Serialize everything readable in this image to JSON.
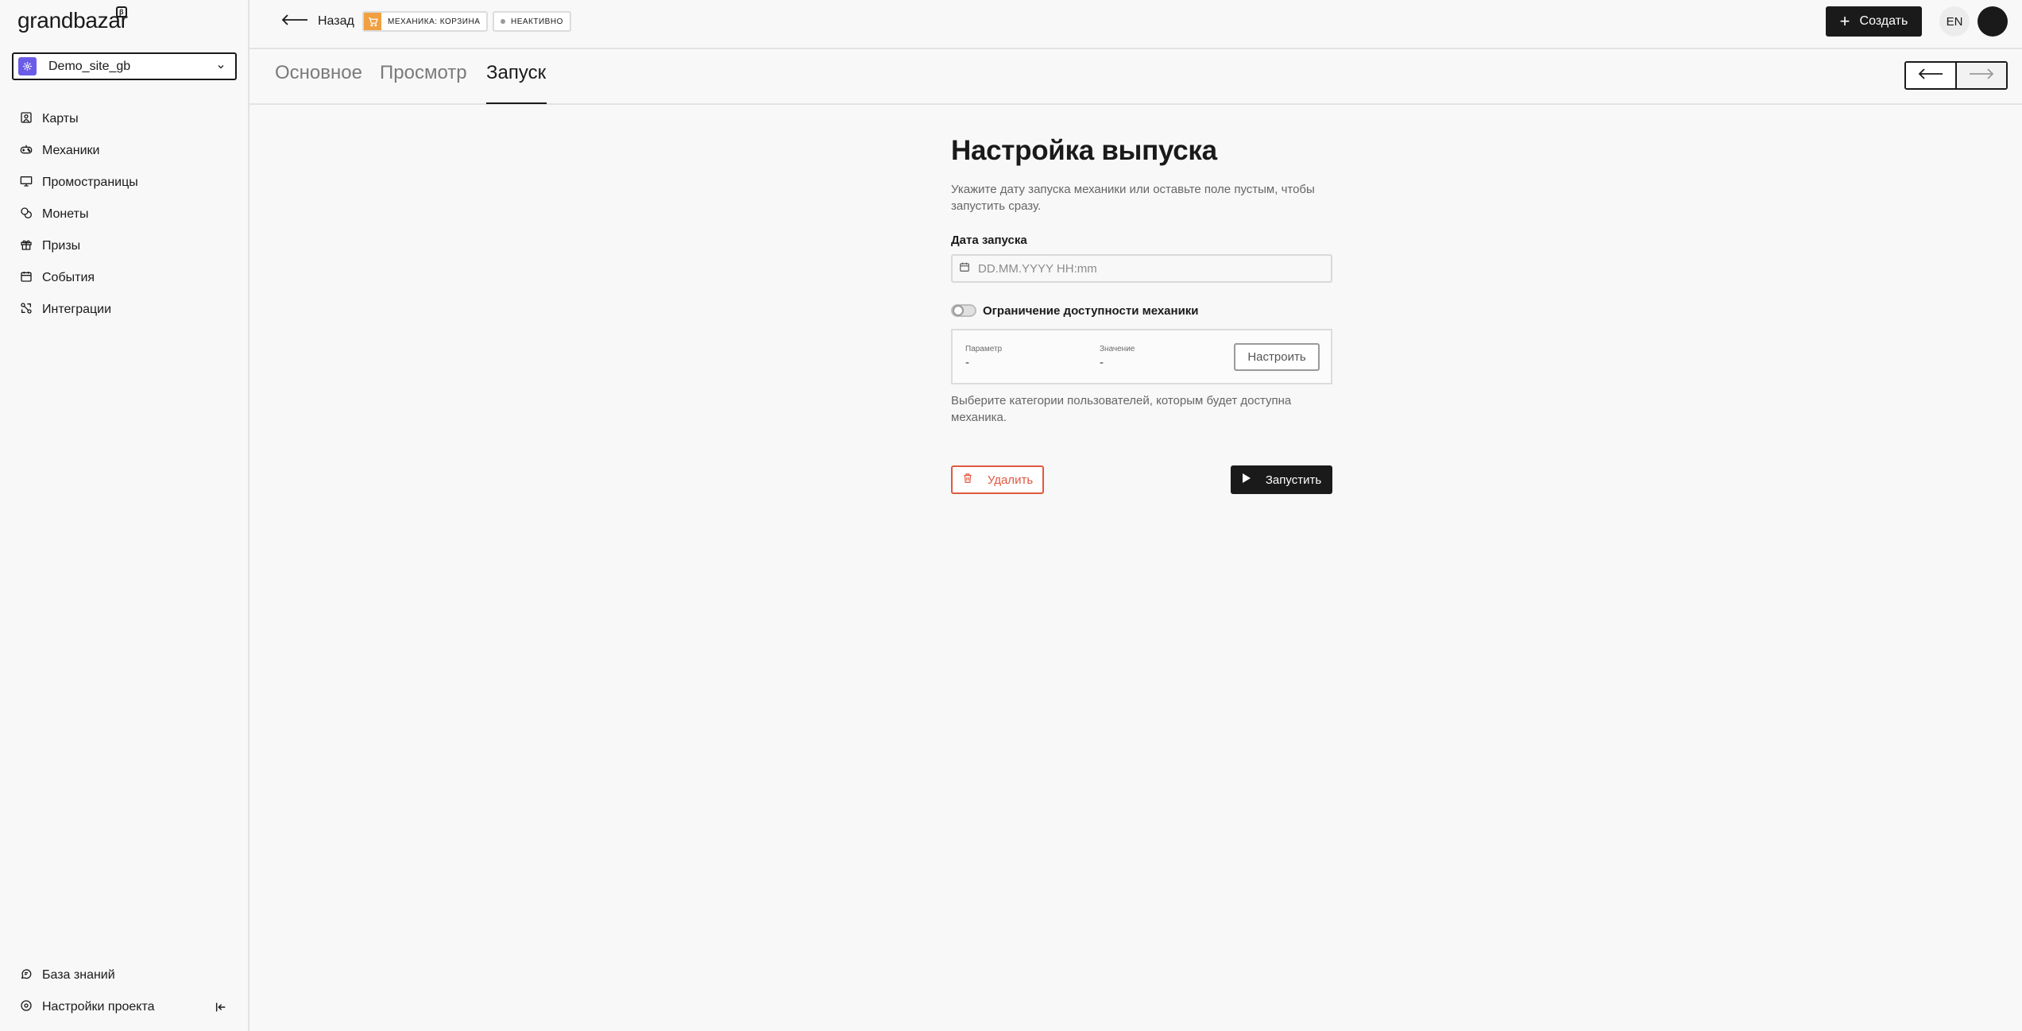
{
  "brand": {
    "name": "grandbazar",
    "badge": "β"
  },
  "project": {
    "name": "Demo_site_gb",
    "accent": "#6b5ce7"
  },
  "sidebar": {
    "items": [
      {
        "label": "Карты",
        "icon": "map-icon"
      },
      {
        "label": "Механики",
        "icon": "gamepad-icon"
      },
      {
        "label": "Промостраницы",
        "icon": "monitor-icon"
      },
      {
        "label": "Монеты",
        "icon": "coins-icon"
      },
      {
        "label": "Призы",
        "icon": "gift-icon"
      },
      {
        "label": "События",
        "icon": "calendar-icon"
      },
      {
        "label": "Интеграции",
        "icon": "integrations-icon"
      }
    ],
    "bottom": [
      {
        "label": "База знаний",
        "icon": "chat-icon"
      },
      {
        "label": "Настройки проекта",
        "icon": "settings-icon"
      }
    ]
  },
  "topbar": {
    "back_label": "Назад",
    "mechanic_badge": "Механика: корзина",
    "status_badge": "Неактивно",
    "create_label": "Создать",
    "lang_label": "EN"
  },
  "tabs": [
    {
      "label": "Основное",
      "active": false
    },
    {
      "label": "Просмотр",
      "active": false
    },
    {
      "label": "Запуск",
      "active": true
    }
  ],
  "form": {
    "title": "Настройка выпуска",
    "description": "Укажите дату запуска механики или оставьте поле пустым, чтобы запустить сразу.",
    "date_label": "Дата запуска",
    "date_placeholder": "DD.MM.YYYY HH:mm",
    "date_value": "",
    "restriction_label": "Ограничение доступности механики",
    "restriction_enabled": false,
    "param_label": "Параметр",
    "param_value": "-",
    "value_label": "Значение",
    "value_value": "-",
    "setup_label": "Настроить",
    "hint": "Выберите категории пользователей, которым будет доступна механика.",
    "delete_label": "Удалить",
    "run_label": "Запустить"
  },
  "colors": {
    "danger": "#e0583f",
    "cart_badge": "#f0a040",
    "primary": "#1a1a1a"
  }
}
